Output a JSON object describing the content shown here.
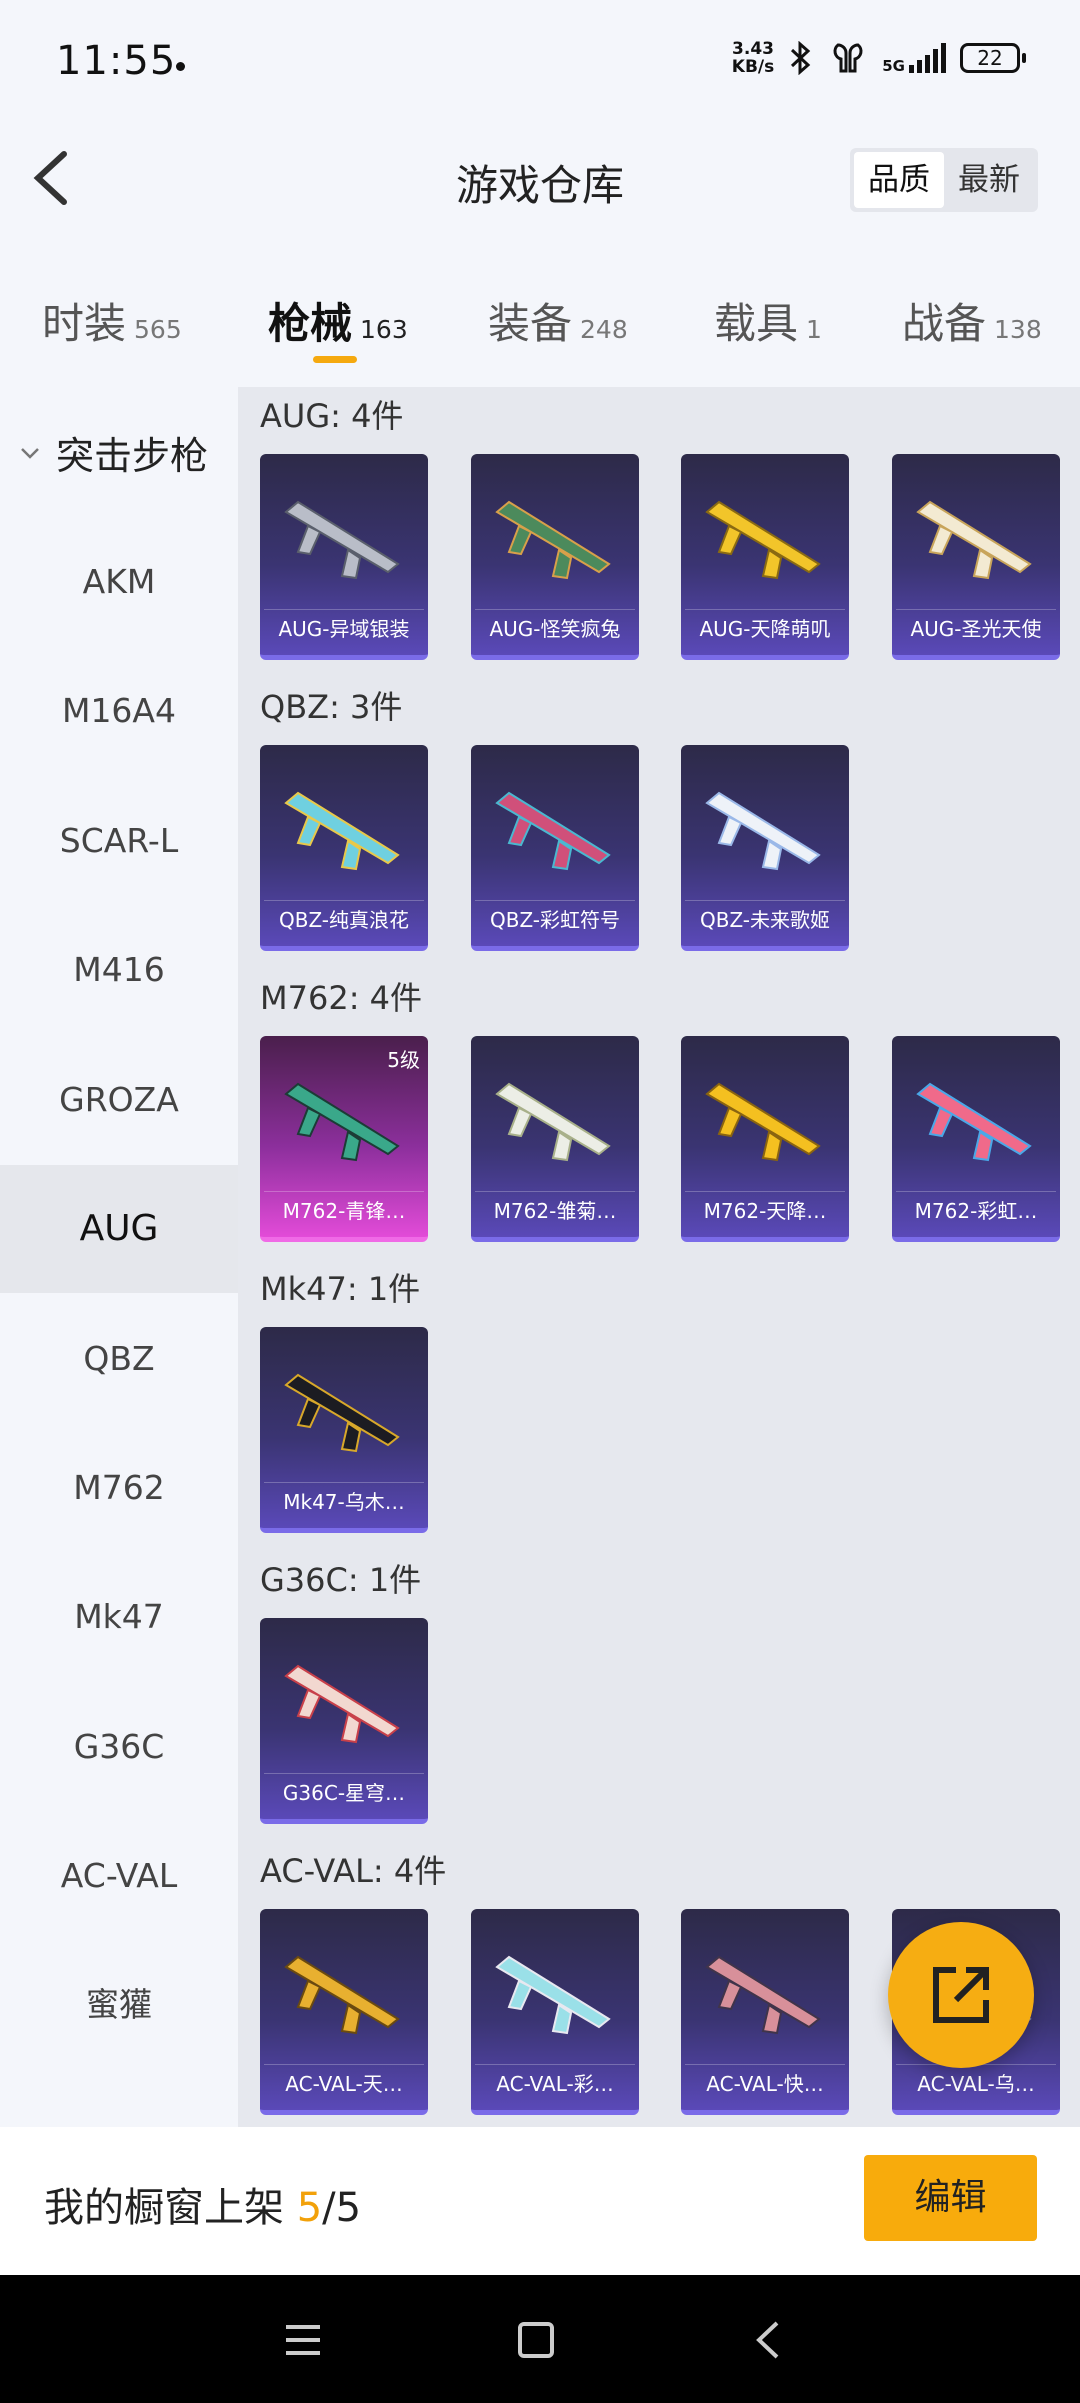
{
  "status_bar": {
    "time": "11:55",
    "speed_value": "3.43",
    "speed_unit": "KB/s",
    "network": "5G",
    "battery": "22"
  },
  "header": {
    "title": "游戏仓库",
    "sort_options": [
      "品质",
      "最新"
    ]
  },
  "tabs": [
    {
      "label": "时装",
      "count": "565"
    },
    {
      "label": "枪械",
      "count": "163"
    },
    {
      "label": "装备",
      "count": "248"
    },
    {
      "label": "载具",
      "count": "1"
    },
    {
      "label": "战备",
      "count": "138"
    }
  ],
  "sidebar": {
    "category": "突击步枪",
    "items": [
      "AKM",
      "M16A4",
      "SCAR-L",
      "M416",
      "GROZA",
      "AUG",
      "QBZ",
      "M762",
      "Mk47",
      "G36C",
      "AC-VAL",
      "蜜獾"
    ],
    "active_item": "AUG"
  },
  "groups": [
    {
      "title": "AUG: 4件",
      "cards": [
        "AUG-异域银装",
        "AUG-怪笑疯兔",
        "AUG-天降萌叽",
        "AUG-圣光天使"
      ]
    },
    {
      "title": "QBZ: 3件",
      "cards": [
        "QBZ-纯真浪花",
        "QBZ-彩虹符号",
        "QBZ-未来歌姬"
      ]
    },
    {
      "title": "M762: 4件",
      "cards": [
        "M762-青锋…",
        "M762-雏菊…",
        "M762-天降…",
        "M762-彩虹…"
      ],
      "first_card_level": "5级"
    },
    {
      "title": "Mk47: 1件",
      "cards": [
        "Mk47-乌木…"
      ]
    },
    {
      "title": "G36C: 1件",
      "cards": [
        "G36C-星穹…"
      ]
    },
    {
      "title": "AC-VAL: 4件",
      "cards": [
        "AC-VAL-天…",
        "AC-VAL-彩…",
        "AC-VAL-快…",
        "AC-VAL-乌…"
      ]
    }
  ],
  "bottom": {
    "shelf_label": "我的橱窗上架",
    "shelf_count": "5",
    "shelf_total": "/5",
    "edit_label": "编辑"
  },
  "colors": {
    "accent": "#f6ad12",
    "card_purple": "#3a3472",
    "card_pink": "#e24bd8"
  }
}
